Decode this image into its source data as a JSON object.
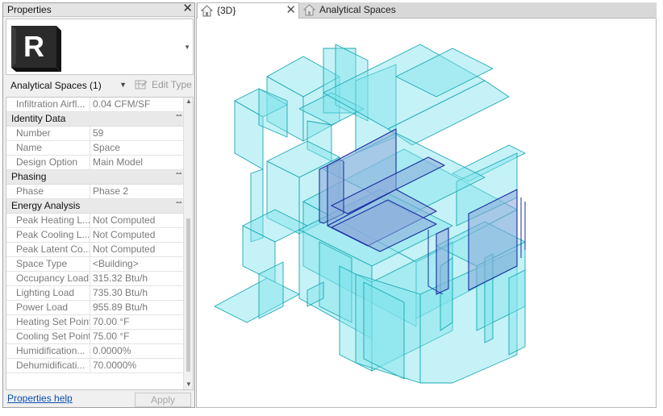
{
  "properties": {
    "title": "Properties",
    "close_glyph": "✕",
    "type_icon": "revit-logo",
    "type_letter": "R",
    "selector_label": "Analytical Spaces (1)",
    "edit_type_label": "Edit Type",
    "rows_top": [
      {
        "label": "Infiltration Airfl...",
        "value": "0.04 CFM/SF"
      }
    ],
    "groups": [
      {
        "name": "Identity Data",
        "rows": [
          {
            "label": "Number",
            "value": "59"
          },
          {
            "label": "Name",
            "value": "Space"
          },
          {
            "label": "Design Option",
            "value": "Main Model"
          }
        ]
      },
      {
        "name": "Phasing",
        "rows": [
          {
            "label": "Phase",
            "value": "Phase 2"
          }
        ]
      },
      {
        "name": "Energy Analysis",
        "rows": [
          {
            "label": "Peak Heating L...",
            "value": "Not Computed"
          },
          {
            "label": "Peak Cooling L...",
            "value": "Not Computed"
          },
          {
            "label": "Peak Latent Co...",
            "value": "Not Computed"
          },
          {
            "label": "Space Type",
            "value": "<Building>"
          },
          {
            "label": "Occupancy Load",
            "value": "315.32 Btu/h"
          },
          {
            "label": "Lighting Load",
            "value": "735.30 Btu/h"
          },
          {
            "label": "Power Load",
            "value": "955.89 Btu/h"
          },
          {
            "label": "Heating Set Point",
            "value": "70.00 °F"
          },
          {
            "label": "Cooling Set Point",
            "value": "75.00 °F"
          },
          {
            "label": "Humidification...",
            "value": "0.0000%"
          },
          {
            "label": "Dehumidificati...",
            "value": "70.0000%"
          }
        ]
      }
    ],
    "collapse_glyph": "⌃",
    "help_label": "Properties help",
    "apply_label": "Apply"
  },
  "tabs": [
    {
      "label": "{3D}",
      "icon": "home-icon",
      "active": true
    },
    {
      "label": "Analytical Spaces",
      "icon": "home-icon",
      "active": false
    }
  ],
  "colors": {
    "space_fill": "#7fe3ea",
    "space_stroke": "#1aa9b3",
    "selected_fill": "#8aa7d8",
    "selected_stroke": "#1a2fa0",
    "link": "#0b4fb3"
  }
}
